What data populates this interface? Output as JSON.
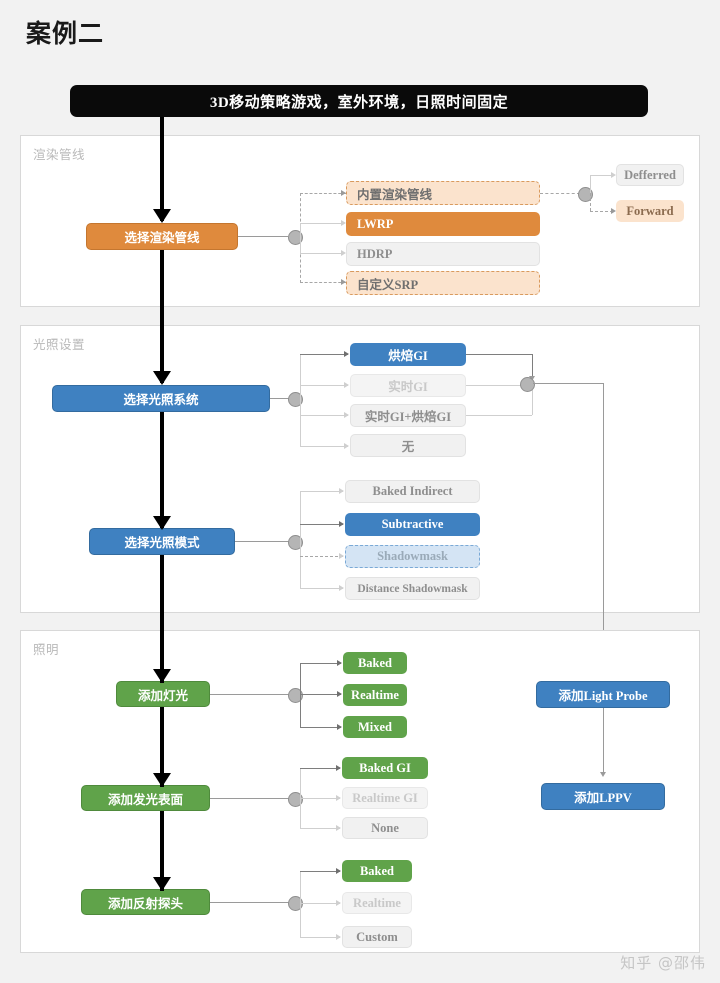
{
  "page": {
    "title": "案例二",
    "banner": "3D移动策略游戏，室外环境，日照时间固定",
    "watermark": "知乎 @邵伟"
  },
  "panels": [
    {
      "label": "渲染管线",
      "nodes": [
        {
          "name": "选择渲染管线",
          "style": "orange"
        }
      ],
      "options_primary": [
        {
          "label": "内置渲染管线",
          "state": "orange-dash"
        },
        {
          "label": "LWRP",
          "state": "orange-solid"
        },
        {
          "label": "HDRP",
          "state": "gray"
        },
        {
          "label": "自定义SRP",
          "state": "orange-dash"
        }
      ],
      "options_secondary": [
        {
          "label": "Defferred",
          "state": "gray"
        },
        {
          "label": "Forward",
          "state": "orange-soft"
        }
      ]
    },
    {
      "label": "光照设置",
      "nodes": [
        {
          "name": "选择光照系统",
          "style": "blue"
        },
        {
          "name": "选择光照模式",
          "style": "blue"
        }
      ],
      "options_system": [
        {
          "label": "烘焙GI",
          "state": "blue-solid"
        },
        {
          "label": "实时GI",
          "state": "gray-lite"
        },
        {
          "label": "实时GI+烘焙GI",
          "state": "gray"
        },
        {
          "label": "无",
          "state": "gray"
        }
      ],
      "options_mode": [
        {
          "label": "Baked Indirect",
          "state": "gray"
        },
        {
          "label": "Subtractive",
          "state": "blue-solid"
        },
        {
          "label": "Shadowmask",
          "state": "blue-dash"
        },
        {
          "label": "Distance Shadowmask",
          "state": "gray"
        }
      ]
    },
    {
      "label": "照明",
      "nodes": [
        {
          "name": "添加灯光",
          "style": "green"
        },
        {
          "name": "添加发光表面",
          "style": "green"
        },
        {
          "name": "添加反射探头",
          "style": "green"
        },
        {
          "name": "添加Light Probe",
          "style": "blue"
        },
        {
          "name": "添加LPPV",
          "style": "blue"
        }
      ],
      "options_light": [
        {
          "label": "Baked",
          "state": "green-solid"
        },
        {
          "label": "Realtime",
          "state": "green-solid"
        },
        {
          "label": "Mixed",
          "state": "green-solid"
        }
      ],
      "options_emissive": [
        {
          "label": "Baked GI",
          "state": "green-solid"
        },
        {
          "label": "Realtime GI",
          "state": "gray-lite"
        },
        {
          "label": "None",
          "state": "gray"
        }
      ],
      "options_probe": [
        {
          "label": "Baked",
          "state": "green-solid"
        },
        {
          "label": "Realtime",
          "state": "gray-lite"
        },
        {
          "label": "Custom",
          "state": "gray"
        }
      ]
    }
  ],
  "colors": {
    "orange": "#df8a3d",
    "blue": "#3f81c1",
    "green": "#60a34a",
    "gray": "#f1f1f1",
    "banner": "#0a0a0a",
    "background": "#f2f2f2"
  }
}
